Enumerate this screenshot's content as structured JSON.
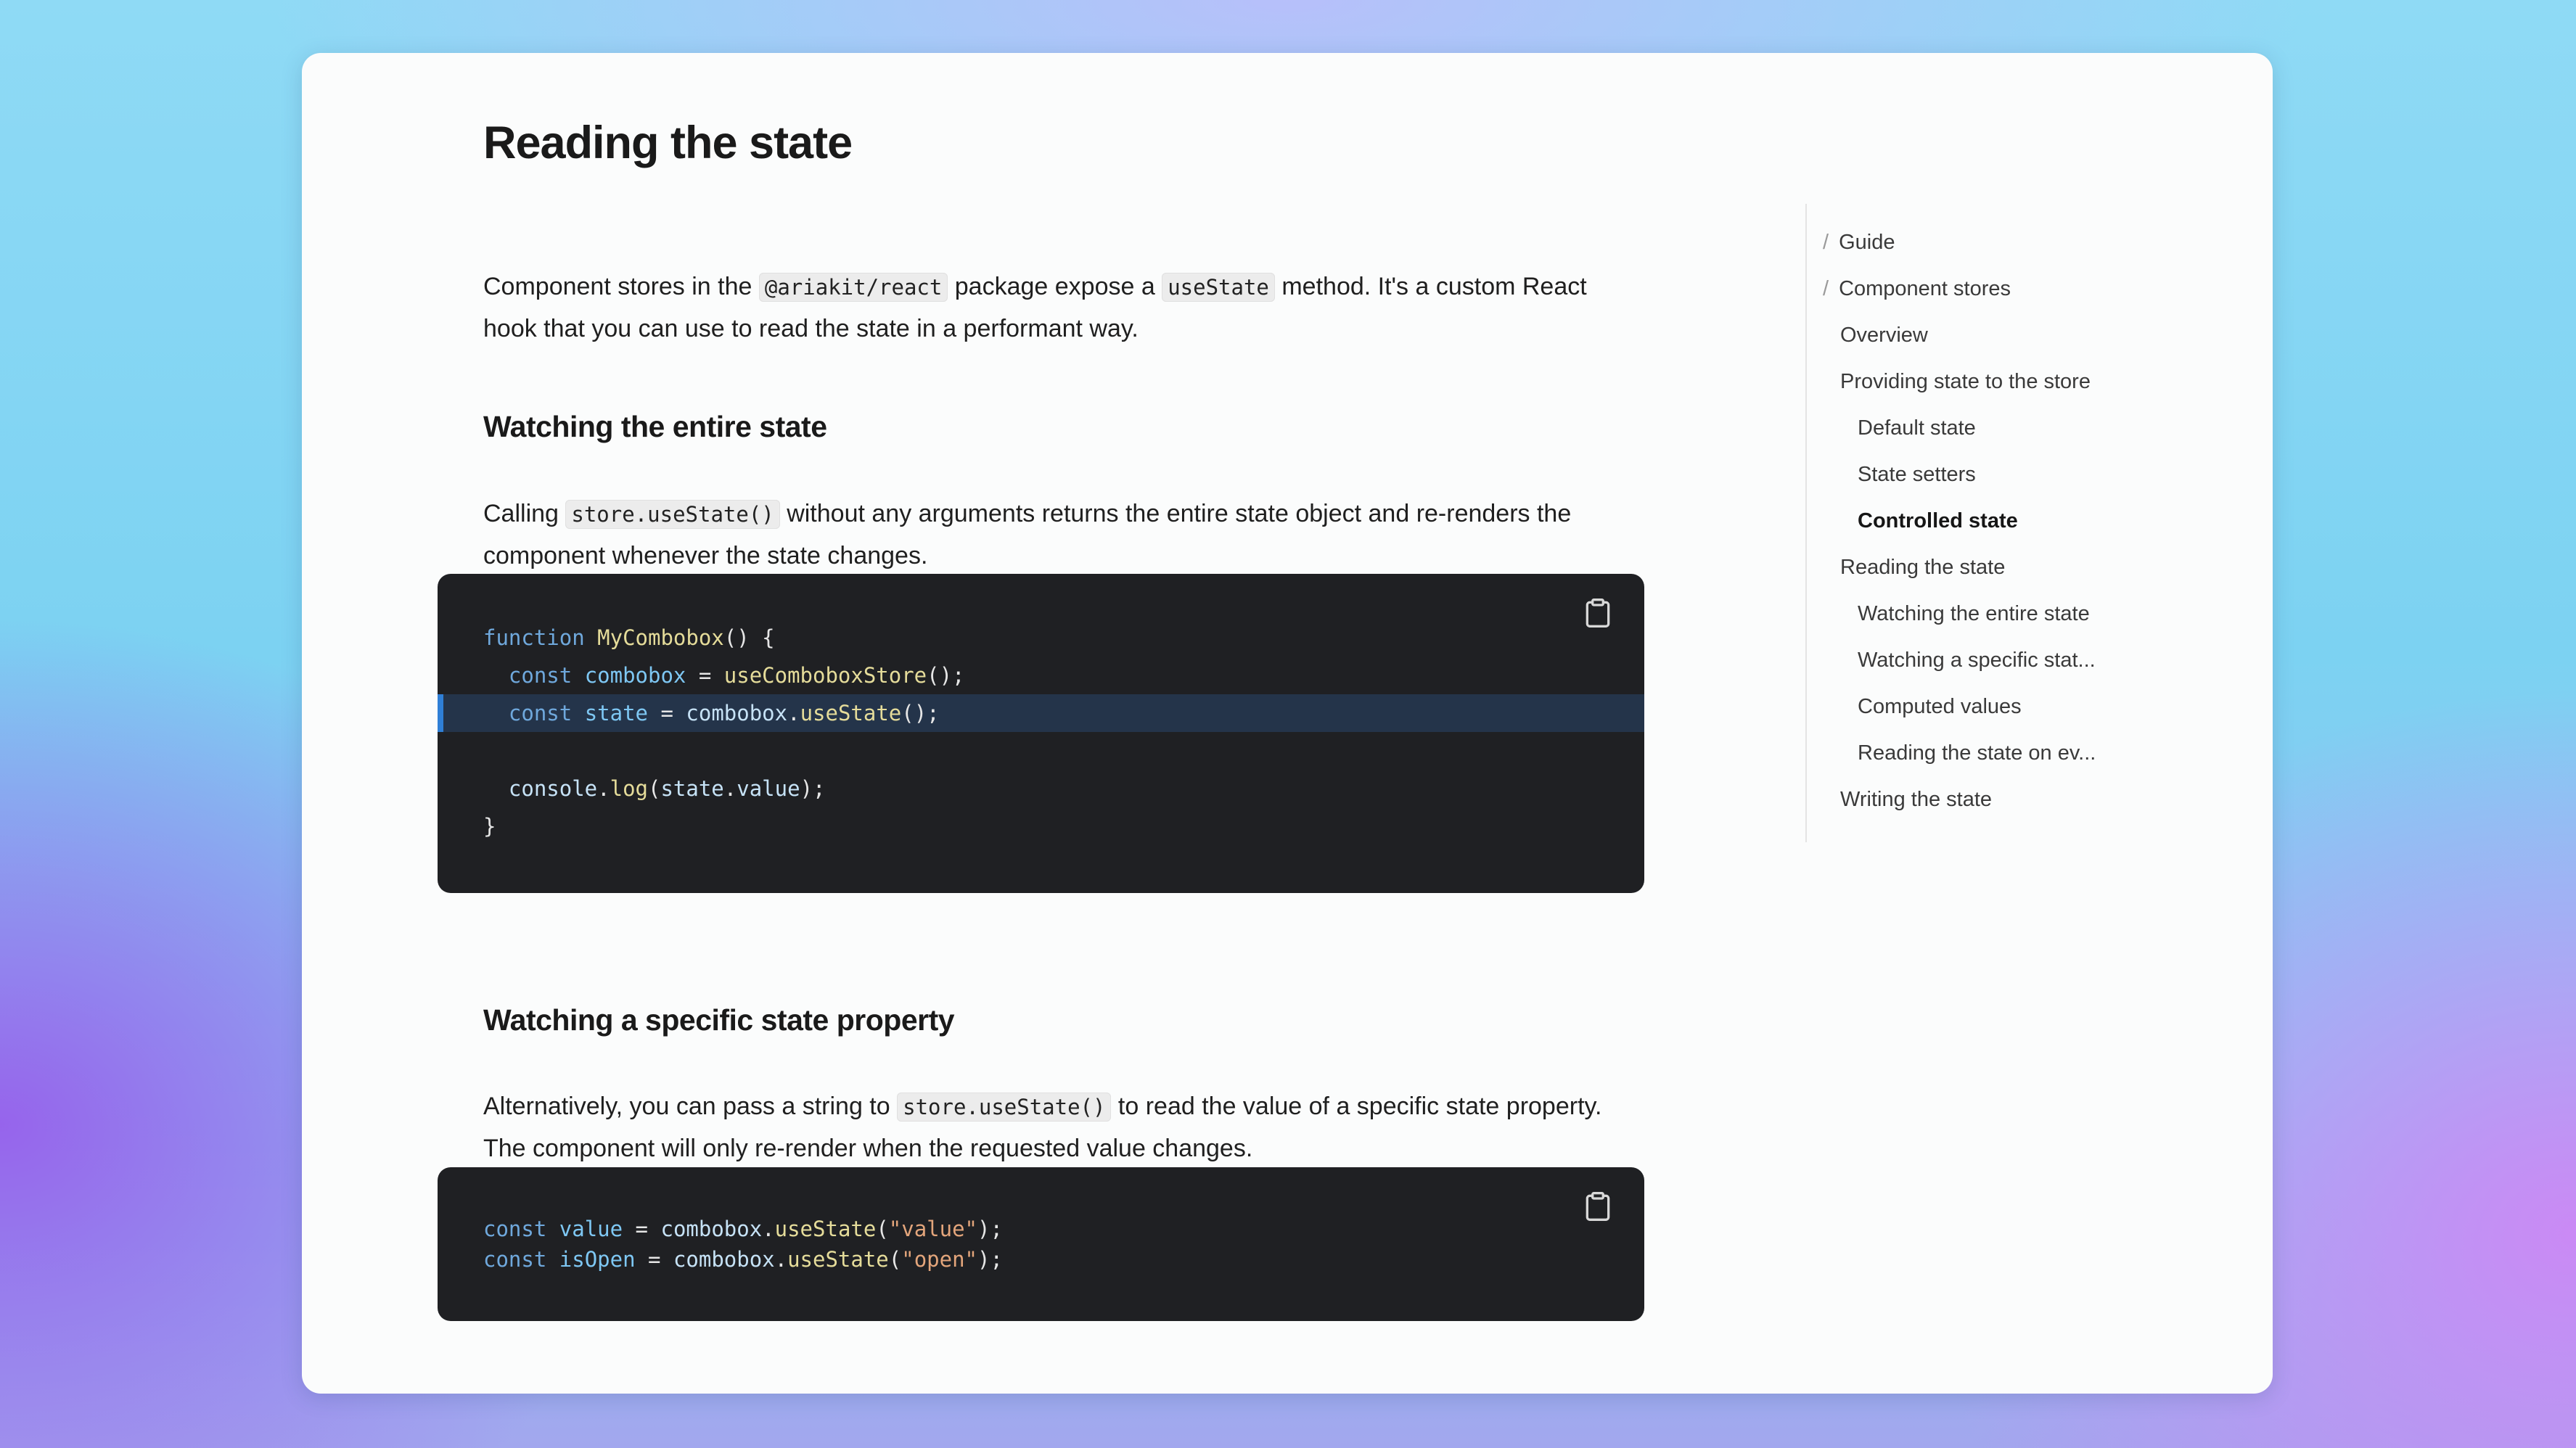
{
  "article": {
    "title": "Reading the state",
    "intro": {
      "t1": "Component stores in the ",
      "c1": "@ariakit/react",
      "t2": " package expose a ",
      "c2": "useState",
      "t3": " method. It's a custom React hook that you can use to read the state in a performant way."
    },
    "section1": {
      "heading": "Watching the entire state",
      "t1": "Calling ",
      "c1": "store.useState()",
      "t2": " without any arguments returns the entire state object and re-renders the component whenever the state changes."
    },
    "code1": {
      "l1": {
        "a": "function",
        "b": " ",
        "c": "MyCombobox",
        "d": "() {"
      },
      "l2": {
        "a": "  ",
        "b": "const",
        "c": " ",
        "d": "combobox",
        "e": " = ",
        "f": "useComboboxStore",
        "g": "();"
      },
      "l3": {
        "a": "  ",
        "b": "const",
        "c": " ",
        "d": "state",
        "e": " = ",
        "f": "combobox",
        "g": ".",
        "h": "useState",
        "i": "();"
      },
      "l5": {
        "a": "  ",
        "b": "console",
        "c": ".",
        "d": "log",
        "e": "(",
        "f": "state",
        "g": ".",
        "h": "value",
        "i": ");"
      },
      "l6": {
        "a": "}"
      }
    },
    "section2": {
      "heading": "Watching a specific state property",
      "t1": "Alternatively, you can pass a string to ",
      "c1": "store.useState()",
      "t2": " to read the value of a specific state property. The component will only re-render when the requested value changes."
    },
    "code2": {
      "l1": {
        "a": "const",
        "b": " ",
        "c": "value",
        "d": " = ",
        "e": "combobox",
        "f": ".",
        "g": "useState",
        "h": "(",
        "i": "\"value\"",
        "j": ");"
      },
      "l2": {
        "a": "const",
        "b": " ",
        "c": "isOpen",
        "d": " = ",
        "e": "combobox",
        "f": ".",
        "g": "useState",
        "h": "(",
        "i": "\"open\"",
        "j": ");"
      }
    },
    "copy_icon": "clipboard-icon"
  },
  "toc": {
    "separator": "/",
    "breadcrumb": [
      "Guide",
      "Component stores"
    ],
    "items": [
      "Overview",
      "Providing state to the store",
      "Default state",
      "State setters",
      "Controlled state",
      "Reading the state",
      "Watching the entire state",
      "Watching a specific stat...",
      "Computed values",
      "Reading the state on ev...",
      "Writing the state"
    ],
    "active_item": "Controlled state"
  },
  "colors": {
    "code_background": "#1f2023",
    "highlight_line": "#24344a",
    "highlight_bar": "#2f7fd6",
    "keyword": "#6fa8dc",
    "function": "#e5dc9a",
    "string": "#e3a57b"
  }
}
